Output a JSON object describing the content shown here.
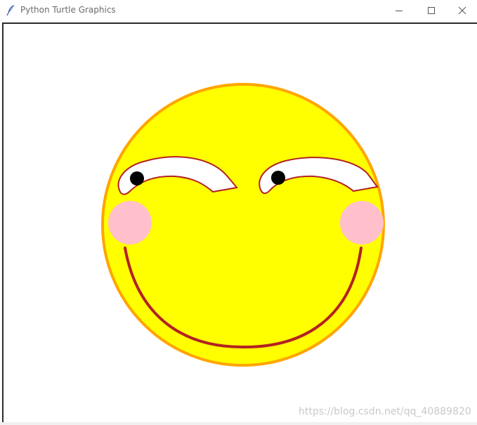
{
  "window": {
    "title": "Python Turtle Graphics",
    "icon": "feather-icon",
    "controls": {
      "minimize_icon": "minimize-icon",
      "maximize_icon": "maximize-icon",
      "close_icon": "close-icon"
    }
  },
  "drawing": {
    "face_fill": "#ffff00",
    "face_outline": "#ffa500",
    "eye_white": "#ffffff",
    "eye_outline": "#b22222",
    "pupil": "#000000",
    "blush": "#ffc0cb",
    "mouth": "#b22222"
  },
  "watermark": "https://blog.csdn.net/qq_40889820"
}
